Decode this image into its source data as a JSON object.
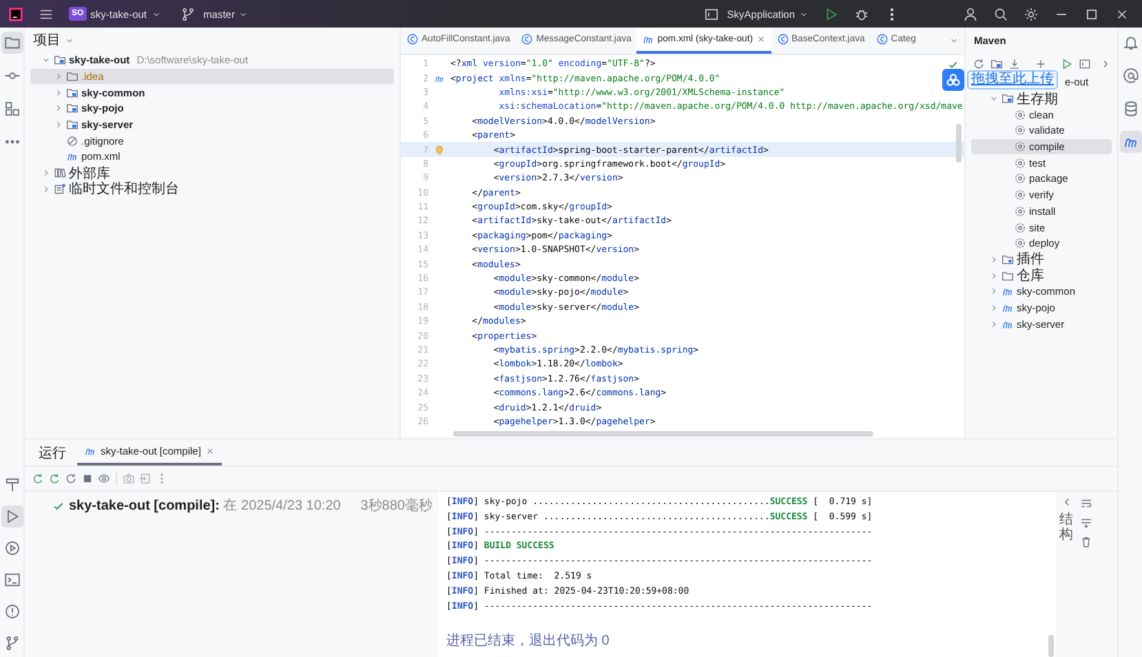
{
  "titlebar": {
    "project_badge": "SO",
    "project": "sky-take-out",
    "branch": "master",
    "run_config": "SkyApplication"
  },
  "left_toolbar": {
    "top": [
      {
        "kind": "project",
        "selected": true
      },
      {
        "kind": "commit",
        "selected": false
      },
      {
        "kind": "structure",
        "selected": false
      },
      {
        "kind": "more",
        "selected": false
      }
    ],
    "bottom": [
      {
        "kind": "build",
        "selected": false
      },
      {
        "kind": "run",
        "selected": true
      },
      {
        "kind": "services",
        "selected": false
      },
      {
        "kind": "terminal",
        "selected": false
      },
      {
        "kind": "problems",
        "selected": false
      },
      {
        "kind": "git",
        "selected": false
      }
    ]
  },
  "project_panel": {
    "title": "项目",
    "tree": [
      {
        "label": "sky-take-out",
        "note": "D:\\software\\sky-take-out",
        "kind": "module",
        "expanded": true,
        "selected": false,
        "children": [
          {
            "label": ".idea",
            "kind": "excluded",
            "expanded": false,
            "selected": true
          },
          {
            "label": "sky-common",
            "kind": "module",
            "expanded": false,
            "selected": false
          },
          {
            "label": "sky-pojo",
            "kind": "module",
            "expanded": false,
            "selected": false
          },
          {
            "label": "sky-server",
            "kind": "module",
            "expanded": false,
            "selected": false
          },
          {
            "label": ".gitignore",
            "kind": "ignore",
            "selected": false
          },
          {
            "label": "pom.xml",
            "kind": "maven",
            "selected": false
          }
        ]
      },
      {
        "label": "外部库",
        "kind": "library",
        "expanded": false,
        "selected": false
      },
      {
        "label": "临时文件和控制台",
        "kind": "scratch",
        "expanded": false,
        "selected": false
      }
    ]
  },
  "editor": {
    "tabs": [
      {
        "label": "AutoFillConstant.java",
        "kind": "class",
        "selected": false
      },
      {
        "label": "MessageConstant.java",
        "kind": "class",
        "selected": false
      },
      {
        "label": "pom.xml (sky-take-out)",
        "kind": "maven",
        "selected": true
      },
      {
        "label": "BaseContext.java",
        "kind": "class",
        "selected": false
      },
      {
        "label": "Categ",
        "kind": "class",
        "selected": false
      }
    ],
    "lines": [
      {
        "n": "1",
        "text": "<?xml version=\"1.0\" encoding=\"UTF-8\"?>",
        "current": false
      },
      {
        "n": "2",
        "text": "<project xmlns=\"http://maven.apache.org/POM/4.0.0\"",
        "current": false,
        "kind": "maven"
      },
      {
        "n": "3",
        "text": "         xmlns:xsi=\"http://www.w3.org/2001/XMLSchema-instance\"",
        "current": false
      },
      {
        "n": "4",
        "text": "         xsi:schemaLocation=\"http://maven.apache.org/POM/4.0.0 http://maven.apache.org/xsd/mave",
        "current": false
      },
      {
        "n": "5",
        "text": "    <modelVersion>4.0.0</modelVersion>",
        "current": false
      },
      {
        "n": "6",
        "text": "    <parent>",
        "current": false
      },
      {
        "n": "7",
        "text": "        <artifactId>spring-boot-starter-parent</artifactId>",
        "current": true,
        "kind": "bulb"
      },
      {
        "n": "8",
        "text": "        <groupId>org.springframework.boot</groupId>",
        "current": false
      },
      {
        "n": "9",
        "text": "        <version>2.7.3</version>",
        "current": false
      },
      {
        "n": "10",
        "text": "    </parent>",
        "current": false
      },
      {
        "n": "11",
        "text": "    <groupId>com.sky</groupId>",
        "current": false
      },
      {
        "n": "12",
        "text": "    <artifactId>sky-take-out</artifactId>",
        "current": false
      },
      {
        "n": "13",
        "text": "    <packaging>pom</packaging>",
        "current": false
      },
      {
        "n": "14",
        "text": "    <version>1.0-SNAPSHOT</version>",
        "current": false
      },
      {
        "n": "15",
        "text": "    <modules>",
        "current": false
      },
      {
        "n": "16",
        "text": "        <module>sky-common</module>",
        "current": false
      },
      {
        "n": "17",
        "text": "        <module>sky-pojo</module>",
        "current": false
      },
      {
        "n": "18",
        "text": "        <module>sky-server</module>",
        "current": false
      },
      {
        "n": "19",
        "text": "    </modules>",
        "current": false
      },
      {
        "n": "20",
        "text": "    <properties>",
        "current": false
      },
      {
        "n": "21",
        "text": "        <mybatis.spring>2.2.0</mybatis.spring>",
        "current": false
      },
      {
        "n": "22",
        "text": "        <lombok>1.18.20</lombok>",
        "current": false
      },
      {
        "n": "23",
        "text": "        <fastjson>1.2.76</fastjson>",
        "current": false
      },
      {
        "n": "24",
        "text": "        <commons.lang>2.6</commons.lang>",
        "current": false
      },
      {
        "n": "25",
        "text": "        <druid>1.2.1</druid>",
        "current": false
      },
      {
        "n": "26",
        "text": "        <pagehelper>1.3.0</pagehelper>",
        "current": false
      }
    ]
  },
  "maven": {
    "title": "Maven",
    "tooltip": "拖拽至此上传",
    "tree": [
      {
        "label": "e-out",
        "kind": "covered",
        "selected": false,
        "children": [
          {
            "label": "生存期",
            "kind": "lifecycle",
            "expanded": true,
            "selected": false,
            "children": [
              {
                "label": "clean",
                "kind": "goal",
                "selected": false
              },
              {
                "label": "validate",
                "kind": "goal",
                "selected": false
              },
              {
                "label": "compile",
                "kind": "goal",
                "selected": true
              },
              {
                "label": "test",
                "kind": "goal",
                "selected": false
              },
              {
                "label": "package",
                "kind": "goal",
                "selected": false
              },
              {
                "label": "verify",
                "kind": "goal",
                "selected": false
              },
              {
                "label": "install",
                "kind": "goal",
                "selected": false
              },
              {
                "label": "site",
                "kind": "goal",
                "selected": false
              },
              {
                "label": "deploy",
                "kind": "goal",
                "selected": false
              }
            ]
          },
          {
            "label": "插件",
            "kind": "plugins",
            "expanded": false,
            "selected": false
          },
          {
            "label": "仓库",
            "kind": "folder",
            "expanded": false,
            "selected": false
          },
          {
            "label": "sky-common",
            "kind": "maven",
            "expanded": false,
            "selected": false
          },
          {
            "label": "sky-pojo",
            "kind": "maven",
            "expanded": false,
            "selected": false
          },
          {
            "label": "sky-server",
            "kind": "maven",
            "expanded": false,
            "selected": false
          }
        ]
      }
    ]
  },
  "right_toolbar": [
    {
      "kind": "bell",
      "selected": false
    },
    {
      "kind": "at",
      "selected": false
    },
    {
      "kind": "database",
      "selected": false
    },
    {
      "kind": "maven",
      "selected": true
    }
  ],
  "run_panel": {
    "title": "运行",
    "tabs": [
      {
        "label": "sky-take-out [compile]",
        "selected": true
      }
    ],
    "task": {
      "text": "**sky-take-out [compile]:** 在 2025/4/23 10:20",
      "duration": "3秒880毫秒",
      "success": true
    },
    "console": [
      {
        "kind": "result",
        "text": "[INFO] sky-pojo ............................................",
        "status": "SUCCESS",
        "time": "[  0.719 s]"
      },
      {
        "kind": "result",
        "text": "[INFO] sky-server ..........................................",
        "status": "SUCCESS",
        "time": "[  0.599 s]"
      },
      {
        "kind": "plain",
        "text": "[INFO] ------------------------------------------------------------------------"
      },
      {
        "kind": "success",
        "text": "[INFO] BUILD SUCCESS"
      },
      {
        "kind": "plain",
        "text": "[INFO] ------------------------------------------------------------------------"
      },
      {
        "kind": "plain",
        "text": "[INFO] Total time:  2.519 s"
      },
      {
        "kind": "plain",
        "text": "[INFO] Finished at: 2025-04-23T10:20:59+08:00"
      },
      {
        "kind": "plain",
        "text": "[INFO] ------------------------------------------------------------------------"
      }
    ],
    "exit_message": "进程已结束，退出代码为 0",
    "side_label": "结构"
  }
}
